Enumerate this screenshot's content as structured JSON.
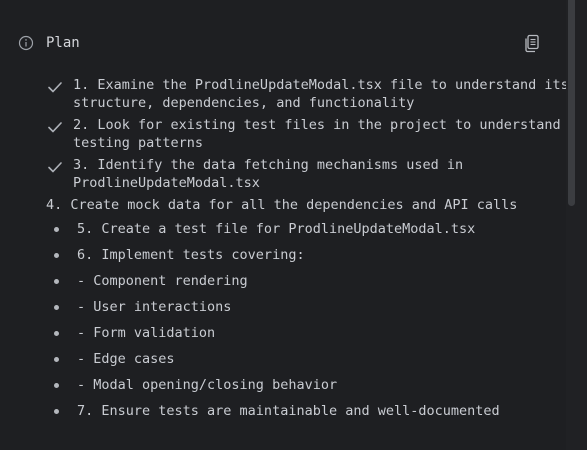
{
  "header": {
    "title": "Plan",
    "info_icon": "info-icon",
    "copy_icon": "copy-icon"
  },
  "colors": {
    "background": "#1e1f22",
    "text": "#c9ccd2",
    "check": "#aeb2b9",
    "scroll_thumb": "#3b3d41"
  },
  "steps": [
    {
      "status": "done",
      "lines": [
        "1. Examine the ProdlineUpdateModal.tsx file to understand its",
        "structure, dependencies, and functionality"
      ]
    },
    {
      "status": "done",
      "lines": [
        "2. Look for existing test files in the project to understand the",
        "testing patterns"
      ]
    },
    {
      "status": "done",
      "lines": [
        "3. Identify the data fetching mechanisms used in",
        "ProdlineUpdateModal.tsx"
      ]
    },
    {
      "status": "plain",
      "lines": [
        "4. Create mock data for all the dependencies and API calls"
      ]
    },
    {
      "status": "pending",
      "lines": [
        "5. Create a test file for ProdlineUpdateModal.tsx"
      ]
    },
    {
      "status": "pending",
      "lines": [
        "6. Implement tests covering:"
      ]
    },
    {
      "status": "pending",
      "lines": [
        "- Component rendering"
      ]
    },
    {
      "status": "pending",
      "lines": [
        "- User interactions"
      ]
    },
    {
      "status": "pending",
      "lines": [
        "- Form validation"
      ]
    },
    {
      "status": "pending",
      "lines": [
        "- Edge cases"
      ]
    },
    {
      "status": "pending",
      "lines": [
        "- Modal opening/closing behavior"
      ]
    },
    {
      "status": "pending",
      "lines": [
        "7. Ensure tests are maintainable and well-documented"
      ]
    }
  ]
}
